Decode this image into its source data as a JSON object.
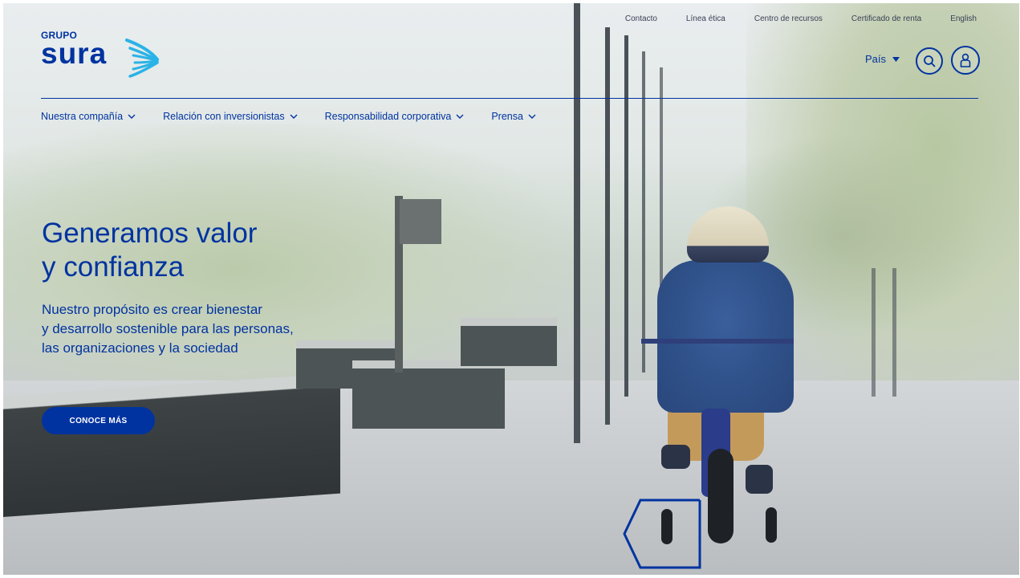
{
  "top_links": [
    "Contacto",
    "Línea ética",
    "Centro de recursos",
    "Certificado de renta",
    "English"
  ],
  "logo": {
    "grupo": "GRUPO",
    "sura": "sura"
  },
  "country": {
    "label": "País"
  },
  "icons": {
    "search": "search-icon",
    "user": "user-icon",
    "chevron": "chevron-down-icon",
    "logo_wing": "sura-wing-icon"
  },
  "main_nav": [
    {
      "label": "Nuestra compañía"
    },
    {
      "label": "Relación con inversionistas"
    },
    {
      "label": "Responsabilidad corporativa"
    },
    {
      "label": "Prensa"
    }
  ],
  "hero": {
    "headline": [
      "Generamos valor",
      "y confianza"
    ],
    "subtext": [
      "Nuestro propósito es crear bienestar",
      "y desarrollo sostenible para las personas,",
      "las organizaciones y la sociedad"
    ],
    "cta": "CONOCE MÁS"
  },
  "colors": {
    "brand_blue": "#0033a0",
    "brand_cyan": "#2ab3e6"
  }
}
